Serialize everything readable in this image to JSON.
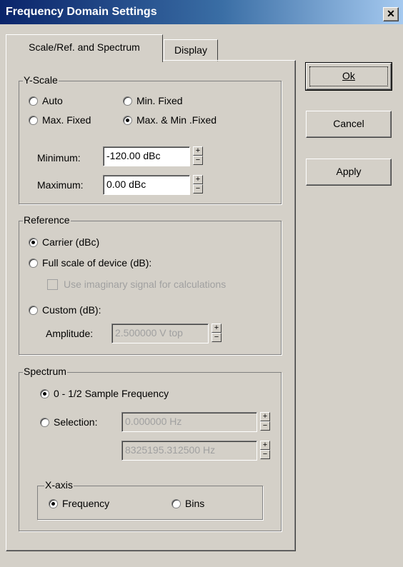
{
  "window": {
    "title": "Frequency Domain Settings",
    "close_label": "✕"
  },
  "tabs": [
    {
      "label": "Scale/Ref. and Spectrum",
      "active": true
    },
    {
      "label": "Display",
      "active": false
    }
  ],
  "yscale": {
    "legend": "Y-Scale",
    "options": [
      {
        "label": "Auto",
        "selected": false
      },
      {
        "label": "Min. Fixed",
        "selected": false
      },
      {
        "label": "Max. Fixed",
        "selected": false
      },
      {
        "label": "Max. & Min .Fixed",
        "selected": true
      }
    ],
    "minimum_label": "Minimum:",
    "minimum_value": "-120.00 dBc",
    "maximum_label": "Maximum:",
    "maximum_value": "0.00 dBc"
  },
  "reference": {
    "legend": "Reference",
    "carrier_label": "Carrier (dBc)",
    "fullscale_label": "Full scale of device (dB):",
    "imaginary_label": "Use imaginary signal for calculations",
    "custom_label": "Custom (dB):",
    "amplitude_label": "Amplitude:",
    "amplitude_value": "2.500000 V top"
  },
  "spectrum": {
    "legend": "Spectrum",
    "half_sample_label": "0 - 1/2 Sample Frequency",
    "selection_label": "Selection:",
    "selection_start": "0.000000 Hz",
    "selection_end": "8325195.312500 Hz",
    "xaxis": {
      "legend": "X-axis",
      "frequency_label": "Frequency",
      "bins_label": "Bins"
    }
  },
  "buttons": {
    "ok": "Ok",
    "cancel": "Cancel",
    "apply": "Apply"
  },
  "spin_glyphs": {
    "up": "+",
    "down": "−"
  }
}
